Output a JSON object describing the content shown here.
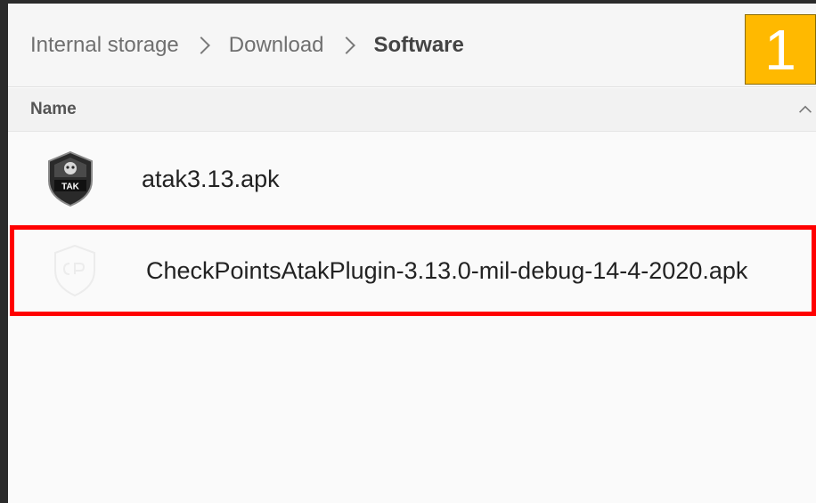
{
  "breadcrumb": {
    "items": [
      "Internal storage",
      "Download",
      "Software"
    ]
  },
  "step_badge": "1",
  "column_header": {
    "name_label": "Name"
  },
  "files": [
    {
      "name": "atak3.13.apk",
      "icon": "tak-app-icon"
    },
    {
      "name": "CheckPointsAtakPlugin-3.13.0-mil-debug-14-4-2020.apk",
      "icon": "plugin-shield-icon"
    }
  ],
  "colors": {
    "badge": "#ffb900",
    "highlight": "#ff0000"
  }
}
